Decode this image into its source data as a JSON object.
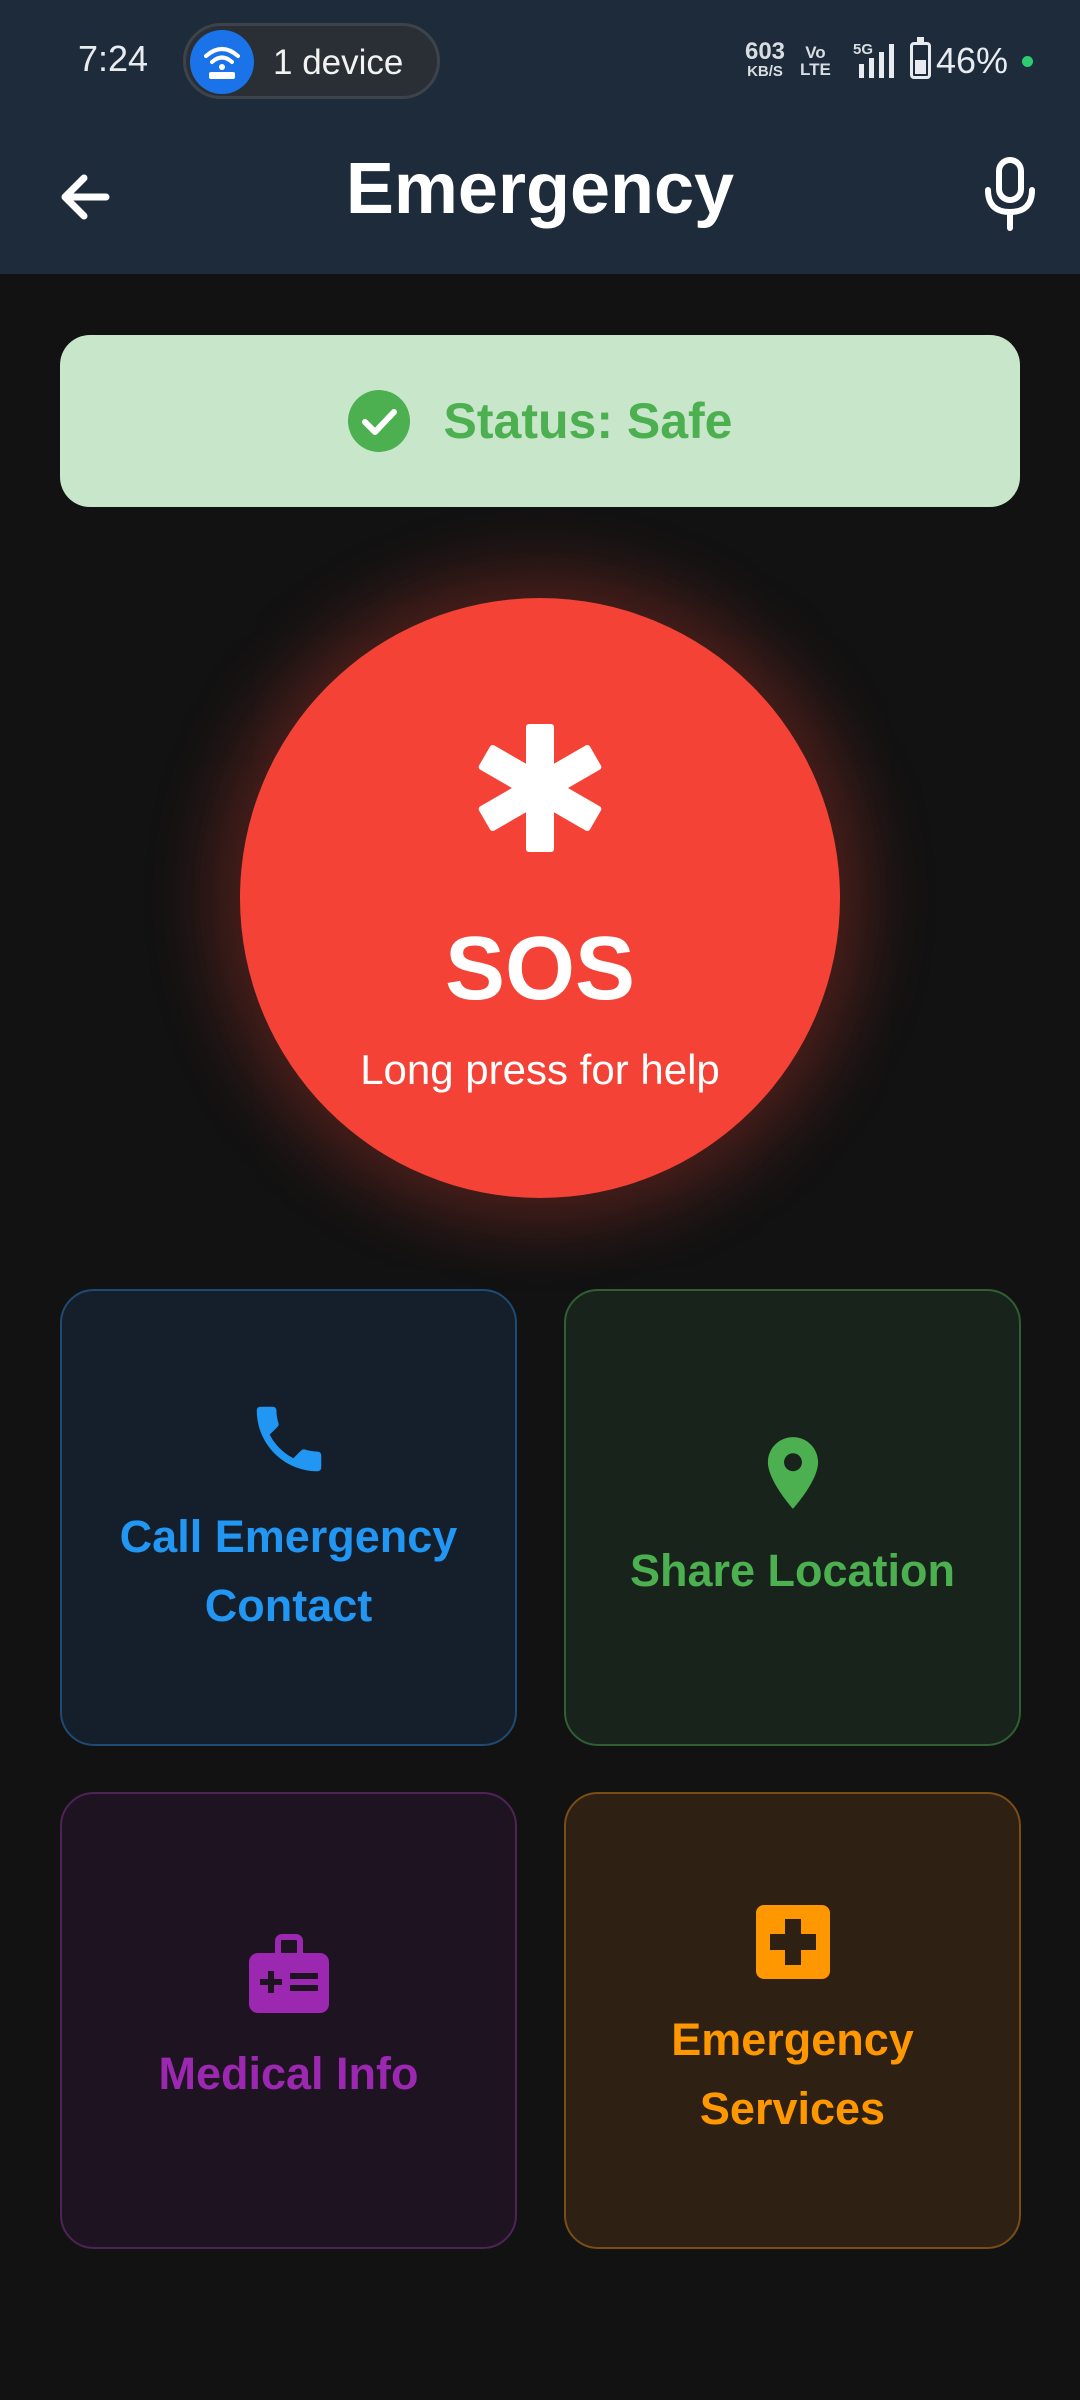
{
  "status_bar": {
    "time": "7:24",
    "hotspot_label": "1 device",
    "net_speed_value": "603",
    "net_speed_unit": "KB/S",
    "volte_top": "Vo",
    "volte_bottom": "LTE",
    "network_type": "5G",
    "battery_percent": "46%"
  },
  "app_bar": {
    "title": "Emergency",
    "back_icon": "arrow-back-icon",
    "mic_icon": "microphone-icon"
  },
  "status_card": {
    "text": "Status: Safe",
    "icon": "check-circle-icon",
    "color": "#4caf50",
    "background": "#c8e6c9"
  },
  "sos_button": {
    "label": "SOS",
    "hint": "Long press for help",
    "icon": "asterisk-icon",
    "color": "#f44336"
  },
  "actions": [
    {
      "label": "Call Emergency Contact",
      "icon": "phone-icon",
      "color": "#2196f3"
    },
    {
      "label": "Share Location",
      "icon": "location-pin-icon",
      "color": "#4caf50"
    },
    {
      "label": "Medical Info",
      "icon": "medical-id-icon",
      "color": "#9c27b0"
    },
    {
      "label": "Emergency Services",
      "icon": "medical-cross-icon",
      "color": "#ff9800"
    }
  ]
}
